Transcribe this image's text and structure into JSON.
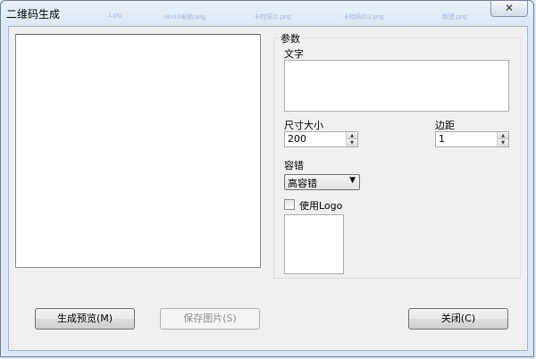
{
  "window": {
    "title": "二维码生成",
    "close_symbol": "✕",
    "background_titles": [
      "1.jpg",
      "win10电脑.png",
      "卡特照片.png",
      "卡特照片2.png",
      "新建.png"
    ]
  },
  "preview": {},
  "params": {
    "group_title": "参数",
    "text_label": "文字",
    "text_value": "",
    "size_label": "尺寸大小",
    "size_value": "200",
    "margin_label": "边距",
    "margin_value": "1",
    "ecc_label": "容错",
    "ecc_selected": "高容错",
    "use_logo_label": "使用Logo",
    "use_logo_checked": false
  },
  "buttons": {
    "preview": "生成预览(M)",
    "save": "保存图片(S)",
    "close": "关闭(C)"
  },
  "icons": {
    "spin_up": "▲",
    "spin_down": "▼",
    "dropdown": "▼"
  }
}
